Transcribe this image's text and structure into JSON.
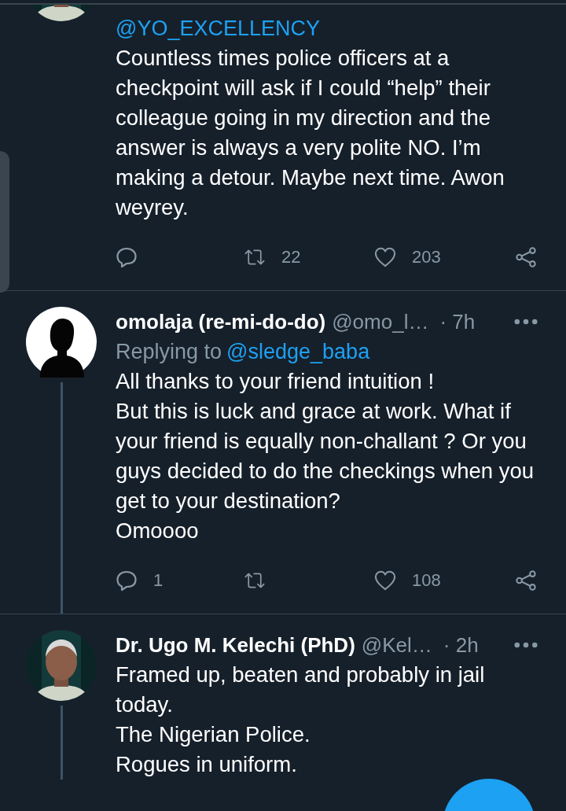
{
  "tweets": [
    {
      "thread_line": false,
      "mentions": "@YO_EXCELLENCY",
      "text": "Countless times police officers at a checkpoint will ask if I could “help” their colleague going in my direction and the answer is always a very polite NO. I’m making a detour. Maybe next time. Awon weyrey.",
      "actions": {
        "retweets": "22",
        "likes": "203"
      }
    },
    {
      "avatar": {
        "kind": "silhouette"
      },
      "thread_line": true,
      "name": "omolaja (re-mi-do-do)",
      "handle": "@omo_l…",
      "time": "· 7h",
      "replying_label": "Replying to",
      "replying_to": "@sledge_baba",
      "text": "All thanks to your friend intuition !\nBut this is luck and grace at work. What if your friend is equally non-challant ? Or you guys decided to do the checkings when you get to your destination?\nOmoooo",
      "actions": {
        "replies": "1",
        "likes": "108"
      }
    },
    {
      "thread_line": true,
      "name": "Dr. Ugo M. Kelechi (PhD)",
      "handle": "@Kel…",
      "time": "· 2h",
      "text": "Framed up, beaten and probably in jail today.\nThe Nigerian Police.\nRogues in uniform."
    }
  ]
}
